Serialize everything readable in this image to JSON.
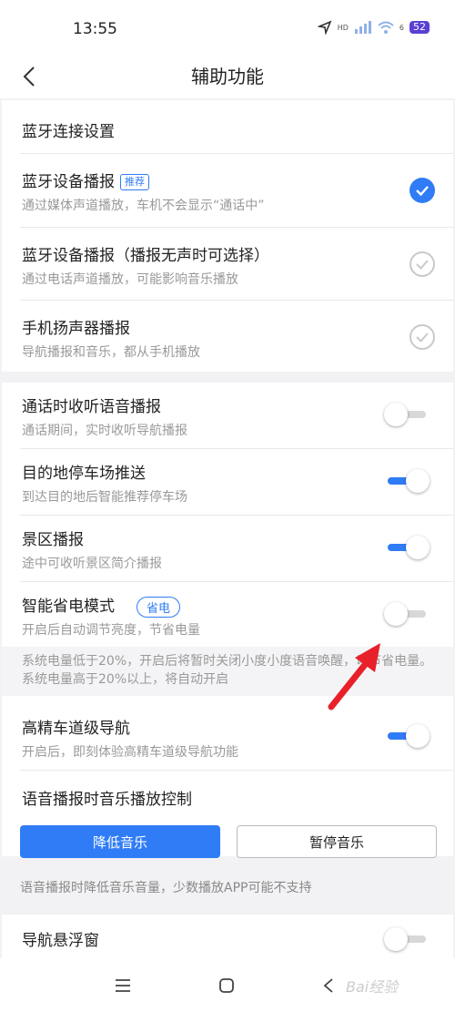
{
  "status": {
    "time": "13:55",
    "battery": "52",
    "network_label": "HD",
    "signal_sub": "6"
  },
  "header": {
    "title": "辅助功能"
  },
  "bluetooth": {
    "section_title": "蓝牙连接设置",
    "options": [
      {
        "title": "蓝牙设备播报",
        "badge": "推荐",
        "sub": "通过媒体声道播放，车机不会显示“通话中”",
        "checked": true
      },
      {
        "title": "蓝牙设备播报（播报无声时可选择）",
        "sub": "通过电话声道播放，可能影响音乐播放",
        "checked": false
      },
      {
        "title": "手机扬声器播报",
        "sub": "导航播报和音乐，都从手机播放",
        "checked": false
      }
    ]
  },
  "settings": [
    {
      "title": "通话时收听语音播报",
      "sub": "通话期间，实时收听导航播报",
      "on": false
    },
    {
      "title": "目的地停车场推送",
      "sub": "到达目的地后智能推荐停车场",
      "on": true
    },
    {
      "title": "景区播报",
      "sub": "途中可收听景区简介播报",
      "on": true
    },
    {
      "title": "智能省电模式",
      "badge": "省电",
      "sub": "开启后自动调节亮度，节省电量",
      "on": false
    },
    {
      "title": "高精车道级导航",
      "sub": "开启后，即刻体验高精车道级导航功能",
      "on": true
    }
  ],
  "power_note": "系统电量低于20%，开启后将暂时关闭小度小度语音唤醒，以节省电量。系统电量高于20%以上，将自动开启",
  "music": {
    "title": "语音播报时音乐播放控制",
    "lower_label": "降低音乐",
    "pause_label": "暂停音乐",
    "hint": "语音播报时降低音乐音量，少数播放APP可能不支持"
  },
  "float_window": {
    "title": "导航悬浮窗",
    "on": false
  },
  "watermark": "Bai经验",
  "colors": {
    "accent": "#2f7cf6",
    "arrow": "#e8202a"
  }
}
